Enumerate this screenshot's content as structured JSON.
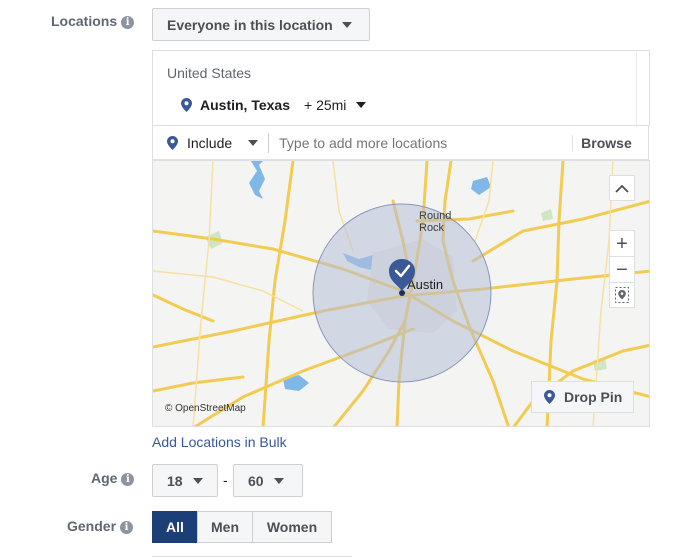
{
  "locations": {
    "label": "Locations",
    "info_glyph": "i",
    "audience_dropdown": "Everyone in this location",
    "country": "United States",
    "city": "Austin, Texas",
    "radius": "+ 25mi",
    "include_label": "Include",
    "search_placeholder": "Type to add more locations",
    "browse_label": "Browse",
    "bulk_link": "Add Locations in Bulk"
  },
  "map": {
    "city_label": "Austin",
    "town_label_line1": "Round",
    "town_label_line2": "Rock",
    "attribution": "© OpenStreetMap",
    "zoom_in": "+",
    "zoom_out": "−",
    "drop_pin_label": "Drop Pin",
    "colors": {
      "water": "#7fb8e6",
      "road": "#f2cb53",
      "land": "#f4f4f2",
      "radius": "#b6bfd8",
      "pin": "#3b5998"
    }
  },
  "age": {
    "label": "Age",
    "min": "18",
    "separator": "-",
    "max": "60"
  },
  "gender": {
    "label": "Gender",
    "options": [
      "All",
      "Men",
      "Women"
    ],
    "selected": "All"
  },
  "colors": {
    "link": "#385898",
    "selected": "#1d3f77",
    "muted": "#606770"
  }
}
